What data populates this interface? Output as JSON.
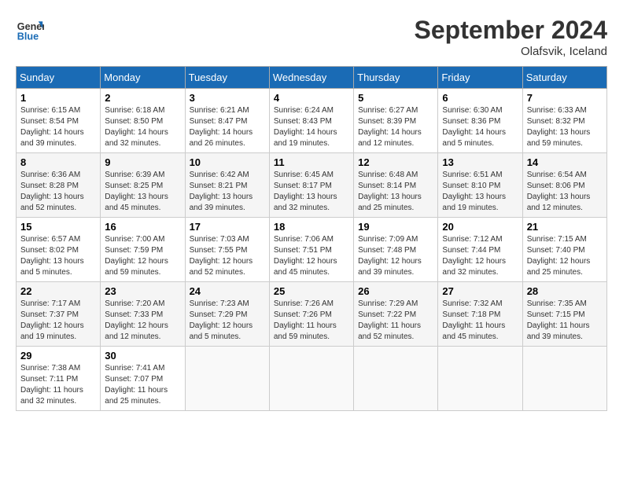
{
  "header": {
    "logo_line1": "General",
    "logo_line2": "Blue",
    "month_year": "September 2024",
    "location": "Olafsvik, Iceland"
  },
  "days_of_week": [
    "Sunday",
    "Monday",
    "Tuesday",
    "Wednesday",
    "Thursday",
    "Friday",
    "Saturday"
  ],
  "weeks": [
    [
      {
        "day": "1",
        "info": "Sunrise: 6:15 AM\nSunset: 8:54 PM\nDaylight: 14 hours\nand 39 minutes."
      },
      {
        "day": "2",
        "info": "Sunrise: 6:18 AM\nSunset: 8:50 PM\nDaylight: 14 hours\nand 32 minutes."
      },
      {
        "day": "3",
        "info": "Sunrise: 6:21 AM\nSunset: 8:47 PM\nDaylight: 14 hours\nand 26 minutes."
      },
      {
        "day": "4",
        "info": "Sunrise: 6:24 AM\nSunset: 8:43 PM\nDaylight: 14 hours\nand 19 minutes."
      },
      {
        "day": "5",
        "info": "Sunrise: 6:27 AM\nSunset: 8:39 PM\nDaylight: 14 hours\nand 12 minutes."
      },
      {
        "day": "6",
        "info": "Sunrise: 6:30 AM\nSunset: 8:36 PM\nDaylight: 14 hours\nand 5 minutes."
      },
      {
        "day": "7",
        "info": "Sunrise: 6:33 AM\nSunset: 8:32 PM\nDaylight: 13 hours\nand 59 minutes."
      }
    ],
    [
      {
        "day": "8",
        "info": "Sunrise: 6:36 AM\nSunset: 8:28 PM\nDaylight: 13 hours\nand 52 minutes."
      },
      {
        "day": "9",
        "info": "Sunrise: 6:39 AM\nSunset: 8:25 PM\nDaylight: 13 hours\nand 45 minutes."
      },
      {
        "day": "10",
        "info": "Sunrise: 6:42 AM\nSunset: 8:21 PM\nDaylight: 13 hours\nand 39 minutes."
      },
      {
        "day": "11",
        "info": "Sunrise: 6:45 AM\nSunset: 8:17 PM\nDaylight: 13 hours\nand 32 minutes."
      },
      {
        "day": "12",
        "info": "Sunrise: 6:48 AM\nSunset: 8:14 PM\nDaylight: 13 hours\nand 25 minutes."
      },
      {
        "day": "13",
        "info": "Sunrise: 6:51 AM\nSunset: 8:10 PM\nDaylight: 13 hours\nand 19 minutes."
      },
      {
        "day": "14",
        "info": "Sunrise: 6:54 AM\nSunset: 8:06 PM\nDaylight: 13 hours\nand 12 minutes."
      }
    ],
    [
      {
        "day": "15",
        "info": "Sunrise: 6:57 AM\nSunset: 8:02 PM\nDaylight: 13 hours\nand 5 minutes."
      },
      {
        "day": "16",
        "info": "Sunrise: 7:00 AM\nSunset: 7:59 PM\nDaylight: 12 hours\nand 59 minutes."
      },
      {
        "day": "17",
        "info": "Sunrise: 7:03 AM\nSunset: 7:55 PM\nDaylight: 12 hours\nand 52 minutes."
      },
      {
        "day": "18",
        "info": "Sunrise: 7:06 AM\nSunset: 7:51 PM\nDaylight: 12 hours\nand 45 minutes."
      },
      {
        "day": "19",
        "info": "Sunrise: 7:09 AM\nSunset: 7:48 PM\nDaylight: 12 hours\nand 39 minutes."
      },
      {
        "day": "20",
        "info": "Sunrise: 7:12 AM\nSunset: 7:44 PM\nDaylight: 12 hours\nand 32 minutes."
      },
      {
        "day": "21",
        "info": "Sunrise: 7:15 AM\nSunset: 7:40 PM\nDaylight: 12 hours\nand 25 minutes."
      }
    ],
    [
      {
        "day": "22",
        "info": "Sunrise: 7:17 AM\nSunset: 7:37 PM\nDaylight: 12 hours\nand 19 minutes."
      },
      {
        "day": "23",
        "info": "Sunrise: 7:20 AM\nSunset: 7:33 PM\nDaylight: 12 hours\nand 12 minutes."
      },
      {
        "day": "24",
        "info": "Sunrise: 7:23 AM\nSunset: 7:29 PM\nDaylight: 12 hours\nand 5 minutes."
      },
      {
        "day": "25",
        "info": "Sunrise: 7:26 AM\nSunset: 7:26 PM\nDaylight: 11 hours\nand 59 minutes."
      },
      {
        "day": "26",
        "info": "Sunrise: 7:29 AM\nSunset: 7:22 PM\nDaylight: 11 hours\nand 52 minutes."
      },
      {
        "day": "27",
        "info": "Sunrise: 7:32 AM\nSunset: 7:18 PM\nDaylight: 11 hours\nand 45 minutes."
      },
      {
        "day": "28",
        "info": "Sunrise: 7:35 AM\nSunset: 7:15 PM\nDaylight: 11 hours\nand 39 minutes."
      }
    ],
    [
      {
        "day": "29",
        "info": "Sunrise: 7:38 AM\nSunset: 7:11 PM\nDaylight: 11 hours\nand 32 minutes."
      },
      {
        "day": "30",
        "info": "Sunrise: 7:41 AM\nSunset: 7:07 PM\nDaylight: 11 hours\nand 25 minutes."
      },
      {
        "day": "",
        "info": ""
      },
      {
        "day": "",
        "info": ""
      },
      {
        "day": "",
        "info": ""
      },
      {
        "day": "",
        "info": ""
      },
      {
        "day": "",
        "info": ""
      }
    ]
  ]
}
